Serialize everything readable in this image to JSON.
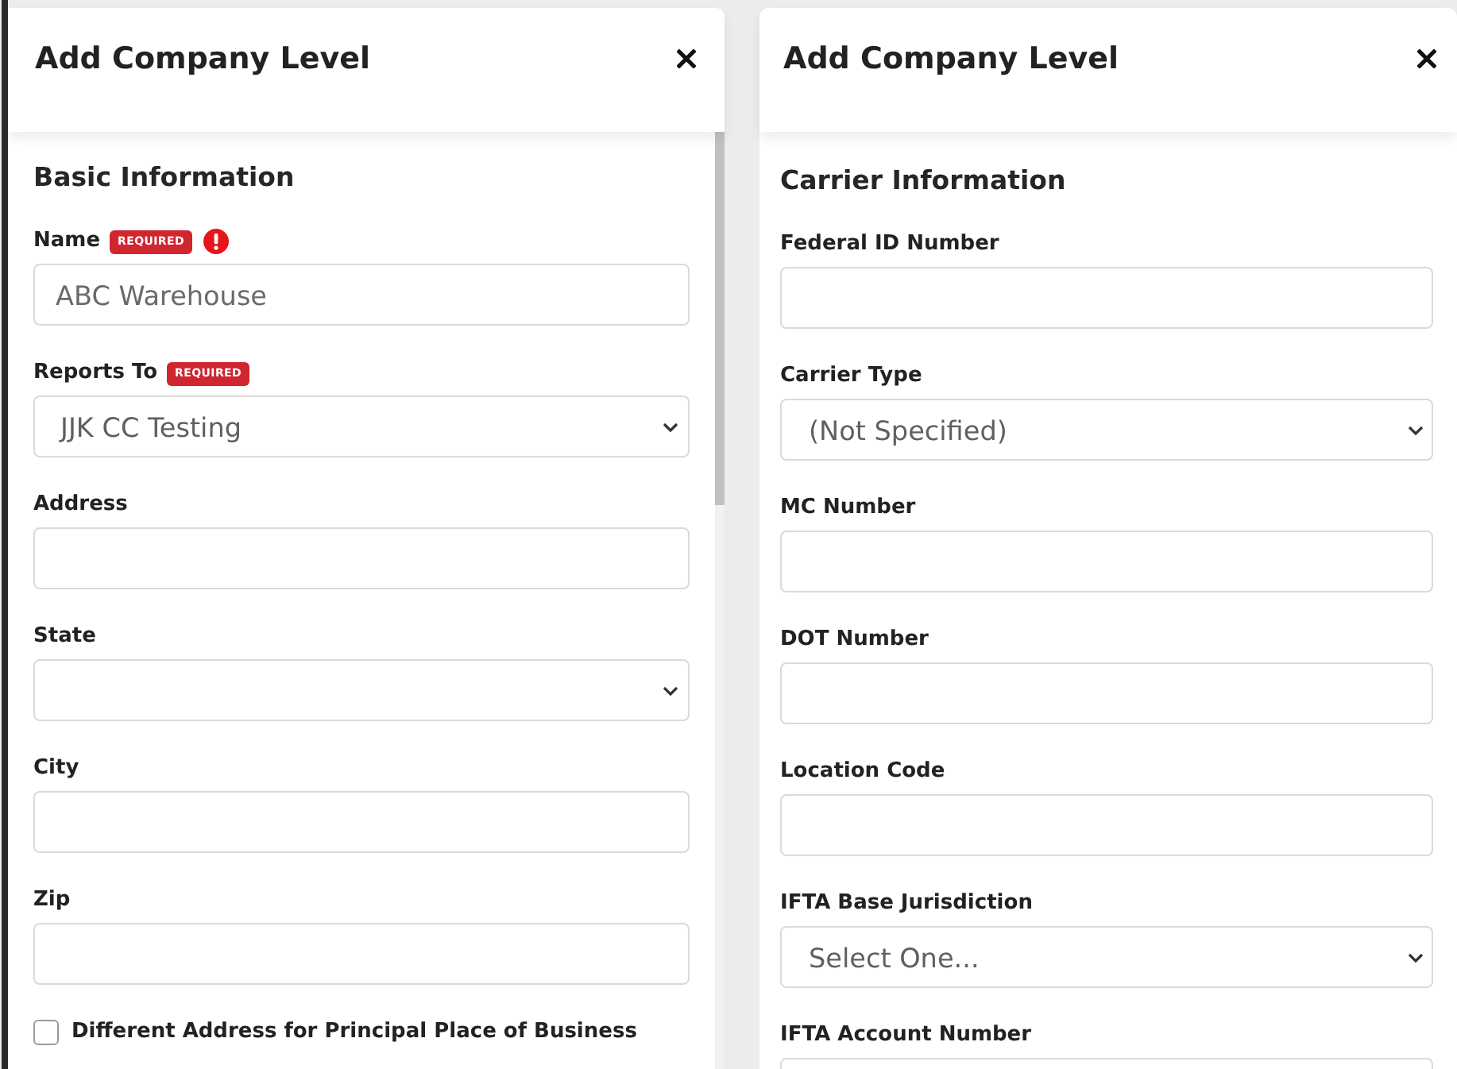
{
  "panels": [
    {
      "title": "Add Company Level",
      "section": "Basic Information",
      "scrollbar": true,
      "fields": [
        {
          "kind": "text",
          "label": "Name",
          "badge": "REQUIRED",
          "error": true,
          "value": "ABC Warehouse"
        },
        {
          "kind": "select",
          "label": "Reports To",
          "badge": "REQUIRED",
          "error": false,
          "value": "JJK CC Testing"
        },
        {
          "kind": "text",
          "label": "Address",
          "error": false
        },
        {
          "kind": "select",
          "label": "State",
          "error": false
        },
        {
          "kind": "text",
          "label": "City",
          "error": false
        },
        {
          "kind": "text",
          "label": "Zip",
          "error": false
        }
      ],
      "checkbox": {
        "label": "Different Address for Principal Place of Business",
        "checked": false
      }
    },
    {
      "title": "Add Company Level",
      "section": "Carrier Information",
      "scrollbar": false,
      "fields": [
        {
          "kind": "text",
          "label": "Federal ID Number",
          "error": false
        },
        {
          "kind": "select",
          "label": "Carrier Type",
          "error": false,
          "value": "(Not Specified)"
        },
        {
          "kind": "text",
          "label": "MC Number",
          "error": false
        },
        {
          "kind": "text",
          "label": "DOT Number",
          "error": false
        },
        {
          "kind": "text",
          "label": "Location Code",
          "error": false
        },
        {
          "kind": "select",
          "label": "IFTA Base Jurisdiction",
          "error": false,
          "value": "Select One..."
        },
        {
          "kind": "text",
          "label": "IFTA Account Number",
          "error": false
        }
      ]
    }
  ]
}
